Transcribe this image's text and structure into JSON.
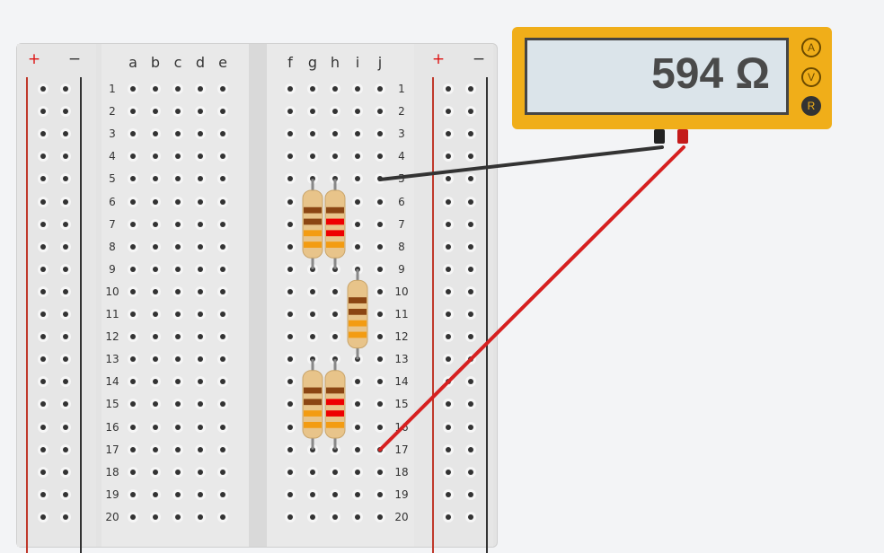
{
  "meter": {
    "reading": "594 Ω",
    "modes": [
      {
        "label": "A",
        "active": false
      },
      {
        "label": "V",
        "active": false
      },
      {
        "label": "R",
        "active": true
      }
    ]
  },
  "breadboard": {
    "rail_plus": "+",
    "rail_minus": "−",
    "left_columns": [
      "a",
      "b",
      "c",
      "d",
      "e"
    ],
    "right_columns": [
      "f",
      "g",
      "h",
      "i",
      "j"
    ],
    "rows": [
      "1",
      "2",
      "3",
      "4",
      "5",
      "6",
      "7",
      "8",
      "9",
      "10",
      "11",
      "12",
      "13",
      "14",
      "15",
      "16",
      "17",
      "18",
      "19",
      "20"
    ]
  },
  "colors": {
    "wire_black": "#333333",
    "wire_red": "#d62020",
    "meter_body": "#f0ae19"
  }
}
